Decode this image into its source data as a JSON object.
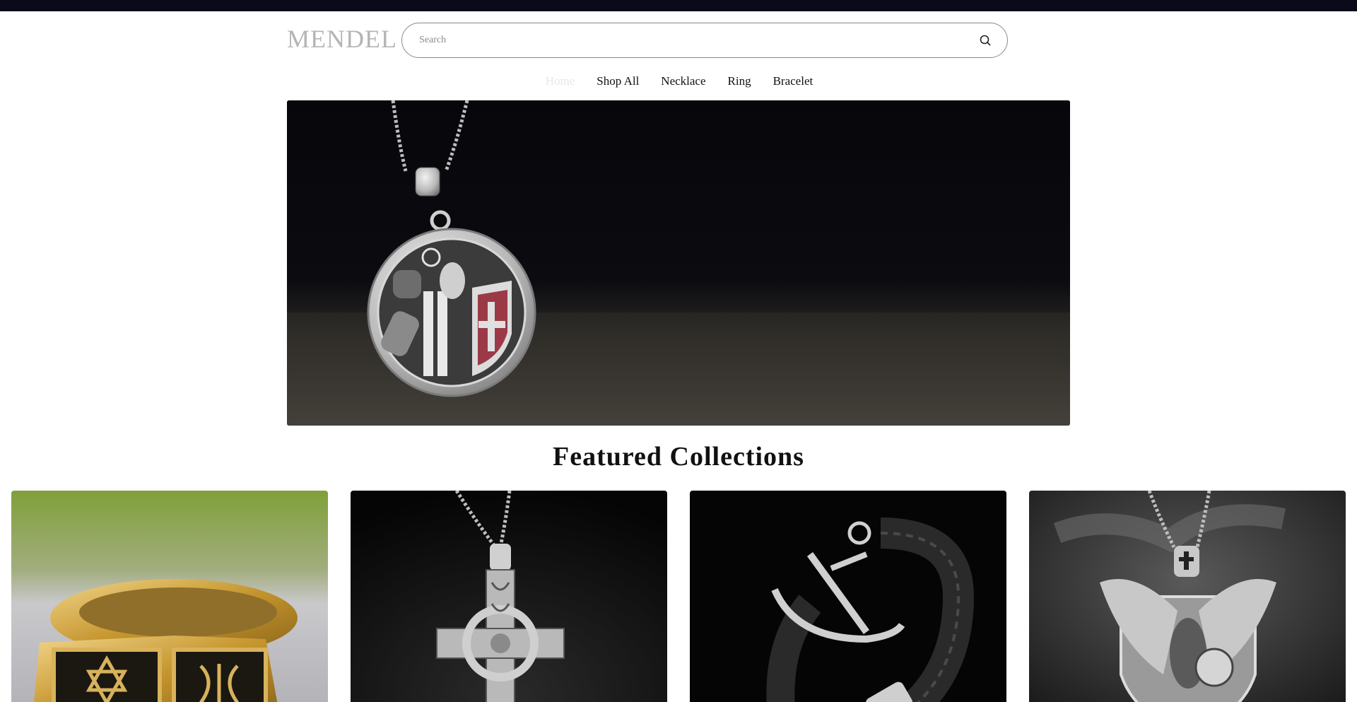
{
  "brand": {
    "name": "MENDEL"
  },
  "search": {
    "placeholder": "Search",
    "icon": "search-icon"
  },
  "nav": {
    "items": [
      {
        "label": "Home",
        "active": true
      },
      {
        "label": "Shop All",
        "active": false
      },
      {
        "label": "Necklace",
        "active": false
      },
      {
        "label": "Ring",
        "active": false
      },
      {
        "label": "Bracelet",
        "active": false
      }
    ]
  },
  "featured": {
    "title": "Featured Collections",
    "collections": [
      {
        "image": "gold star of david ring"
      },
      {
        "image": "celtic cross pendant necklace"
      },
      {
        "image": "anchor leather bracelet"
      },
      {
        "image": "eagle shield pendant necklace"
      }
    ]
  },
  "hero": {
    "image": "templar knight medallion necklace"
  },
  "colors": {
    "topbar": "#0b0a1a",
    "logo": "#b5b5b5",
    "nav_active": "#e8e8e8",
    "text": "#111111"
  }
}
